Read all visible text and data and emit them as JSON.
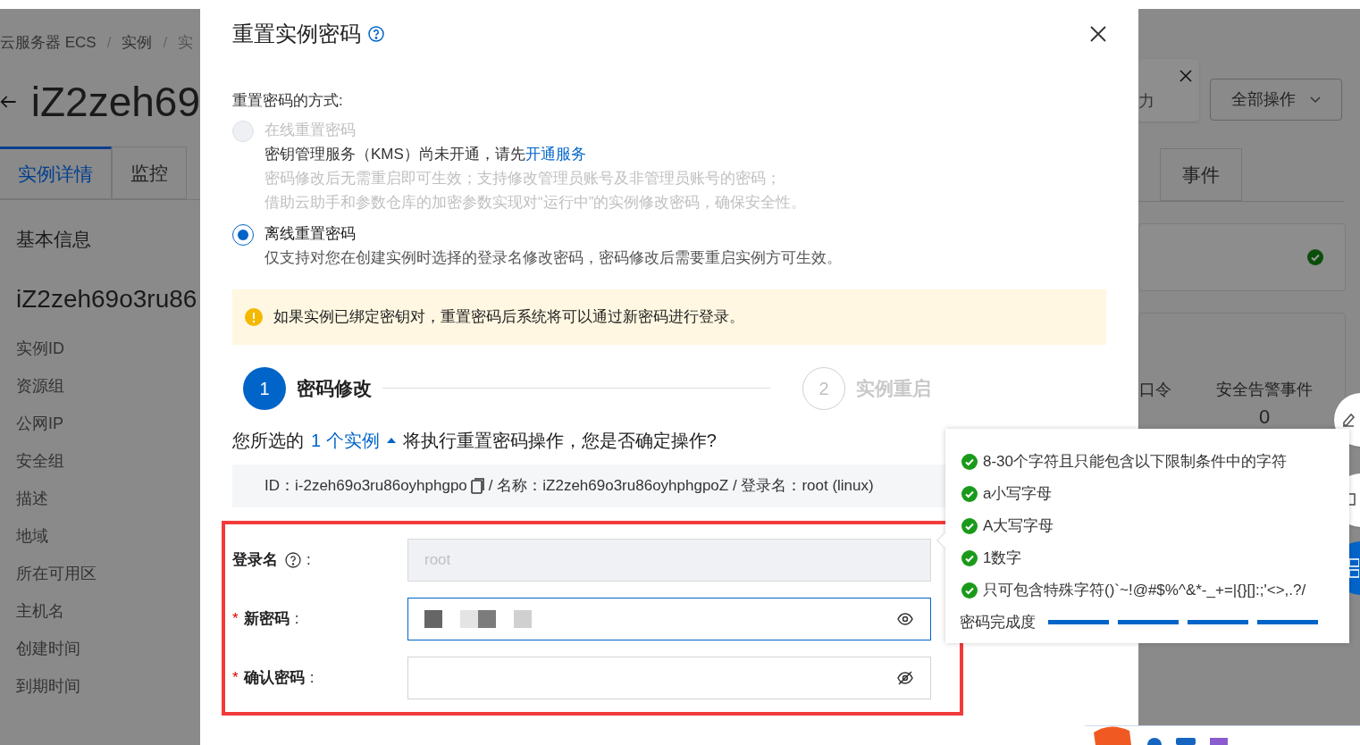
{
  "background": {
    "breadcrumb": [
      {
        "kind": "link",
        "text": "云服务器 ECS"
      },
      {
        "kind": "separator",
        "text": "/"
      },
      {
        "kind": "link",
        "text": "实例"
      },
      {
        "kind": "separator",
        "text": "/"
      },
      {
        "kind": "current",
        "text": "实"
      }
    ],
    "title": "iZ2zeh69",
    "tabs": [
      {
        "label": "实例详情",
        "selected": true
      },
      {
        "label": "监控",
        "selected": false
      }
    ],
    "right_tabs": [
      {
        "label": "事件",
        "selected": false
      }
    ],
    "section_title": "基本信息",
    "instance_name": "iZ2zeh69o3ru86",
    "fields": [
      "实例ID",
      "资源组",
      "公网IP",
      "安全组",
      "描述",
      "地域",
      "所在可用区",
      "主机名",
      "创建时间",
      "到期时间"
    ],
    "all_actions": "全部操作",
    "toast_text": "力",
    "stats": [
      {
        "label": "口令"
      },
      {
        "label": "安全告警事件",
        "value": "0"
      }
    ]
  },
  "dialog": {
    "title": "重置实例密码",
    "method_label": "重置密码的方式:",
    "options": [
      {
        "label": "在线重置密码",
        "selected": false,
        "disabled": true,
        "notice": "密钥管理服务（KMS）尚未开通，请先",
        "notice_link": "开通服务",
        "lines": [
          "密码修改后无需重启即可生效；支持修改管理员账号及非管理员账号的密码；",
          "借助云助手和参数仓库的加密参数实现对“运行中”的实例修改密码，确保安全性。"
        ]
      },
      {
        "label": "离线重置密码",
        "selected": true,
        "disabled": false,
        "lines": [
          "仅支持对您在创建实例时选择的登录名修改密码，密码修改后需要重启实例方可生效。"
        ]
      }
    ],
    "alert": "如果实例已绑定密钥对，重置密码后系统将可以通过新密码进行登录。",
    "steps": [
      {
        "number": "1",
        "label": "密码修改",
        "selected": true
      },
      {
        "number": "2",
        "label": "实例重启",
        "selected": false
      }
    ],
    "confirm": {
      "before": "您所选的",
      "link": "1 个实例",
      "after": "将执行重置密码操作，您是否确定操作?"
    },
    "instance": {
      "id": "ID：i-2zeh69o3ru86oyhphgpo",
      "rest": "/ 名称：iZ2zeh69o3ru86oyhphgpoZ / 登录名：root (linux)"
    },
    "form": [
      {
        "label": "登录名",
        "colon": ":",
        "help": true,
        "disabled": true,
        "focused": false,
        "value": "root"
      },
      {
        "required_mark": "*",
        "label": "新密码",
        "colon": ":",
        "help": false,
        "disabled": false,
        "redacted": true,
        "visible": true,
        "focused": true
      },
      {
        "required_mark": "*",
        "label": "确认密码",
        "colon": ":",
        "help": false,
        "disabled": false,
        "visible": false,
        "focused": false
      }
    ]
  },
  "popover": {
    "rules": [
      {
        "text": "8-30个字符且只能包含以下限制条件中的字符",
        "checked": true
      },
      {
        "text": "a小写字母",
        "checked": true
      },
      {
        "text": "A大写字母",
        "checked": true
      },
      {
        "text": "1数字",
        "checked": true
      },
      {
        "text": "只可包含特殊字符()`~!@#$%^&*-_+=|{}[]:;'<>,.?/",
        "checked": true
      }
    ],
    "strength_label": "密码完成度",
    "segments": [
      {
        "level": 1
      },
      {
        "level": 1
      },
      {
        "level": 1
      },
      {
        "level": 1
      }
    ]
  }
}
